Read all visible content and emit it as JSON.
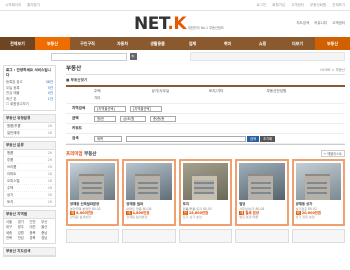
{
  "topbar": {
    "left": [
      "시작페이지",
      "즐겨찾기"
    ],
    "right": [
      "로그인",
      "회원가입",
      "고객센터",
      "부동산회원",
      "전체보기"
    ]
  },
  "header": {
    "logo_main": "NET",
    "logo_accent": ".K",
    "slogan": "대한민국 No.1 부동산정보",
    "util": [
      "지도검색",
      "커뮤니티",
      "고객센터"
    ]
  },
  "nav": [
    "전체보기",
    "부동산",
    "구인구직",
    "자동차",
    "생활용품",
    "업체",
    "취미",
    "쇼핑",
    "더보기",
    "부동산"
  ],
  "search": {
    "button": "🔍"
  },
  "sidebar": {
    "login_box": {
      "title": "로그 : 안녕하세요 서비스입니다",
      "rows": [
        {
          "k": "등록된 광고",
          "v": "38건"
        },
        {
          "k": "오늘 등록",
          "v": "5건"
        },
        {
          "k": "관심 매물",
          "v": "0건"
        },
        {
          "k": "최근 본",
          "v": "1건"
        }
      ],
      "check": "회원광고보기"
    },
    "sec1": {
      "title": "부동산 유형분류",
      "rows": [
        {
          "k": "원룸/투룸",
          "c": "26"
        },
        {
          "k": "일반매매",
          "c": "26"
        }
      ]
    },
    "sec2": {
      "title": "부동산 분류",
      "rows": [
        {
          "k": "원룸",
          "c": "26"
        },
        {
          "k": "투룸",
          "c": "26"
        },
        {
          "k": "쓰리룸",
          "c": "26"
        },
        {
          "k": "아파트",
          "c": "26"
        },
        {
          "k": "오피스텔",
          "c": "26"
        },
        {
          "k": "주택",
          "c": "26"
        },
        {
          "k": "상가",
          "c": "26"
        },
        {
          "k": "토지",
          "c": "26"
        }
      ]
    },
    "sec3": {
      "title": "부동산 지역별",
      "cells": [
        "서울",
        "경기",
        "인천",
        "부산",
        "대구",
        "광주",
        "대전",
        "울산",
        "세종",
        "강원",
        "충북",
        "충남",
        "전북",
        "전남",
        "경북",
        "경남",
        "제주",
        "해외",
        "기타",
        "전체"
      ]
    },
    "sec4": {
      "title": "부동산 지도검색"
    }
  },
  "main": {
    "title": "부동산",
    "breadcrumb": "HOME > 부동산",
    "subtitle": "■ 부동산찾기",
    "filter": {
      "row1_label": "",
      "row1_opts": [
        "주택",
        "상가/사무실",
        "토지/기타",
        "부동산전성원"
      ],
      "row1_extra": "기타",
      "region_label": "지역검색",
      "region_sel": [
        "[지역을선택]",
        "[지역을선택]"
      ],
      "price_label": "금액",
      "price_sel": [
        "원/만",
        "상/조/원",
        "층/층/층"
      ],
      "keyword_label": "키워드",
      "search_label": "검색",
      "search_sel": "제목",
      "search_btn": "검색",
      "reset_btn": "초기화"
    },
    "premium": {
      "title_a": "프리미엄",
      "title_b": " 부동산",
      "more": "+ 매물리스트"
    },
    "cards": [
      {
        "name": "양재동 신축빌라분양",
        "sub": "분양주택 분양전 80.02",
        "tag": "매",
        "price": "8,000만원",
        "loc": "양재동 월세분양"
      },
      {
        "name": "양재동 빌라",
        "sub": "아파트 연봉 80.08",
        "tag": "매",
        "price": "4,800만원",
        "loc": "양재동 월세분양"
      },
      {
        "name": "토지",
        "sub": "원룸/투룸 토지 80.05",
        "tag": "전",
        "price": "18,800만원",
        "loc": "토지 상가 분양"
      },
      {
        "name": "빌딩",
        "sub": "사무실/상가 80.08",
        "tag": "매",
        "price": "월세 분양",
        "loc": "빌딩 분양 매물"
      },
      {
        "name": "양재동 상가",
        "sub": "상가점포 80.02",
        "tag": "매",
        "price": "20,000만원",
        "loc": "상가 임대 분양"
      }
    ]
  }
}
